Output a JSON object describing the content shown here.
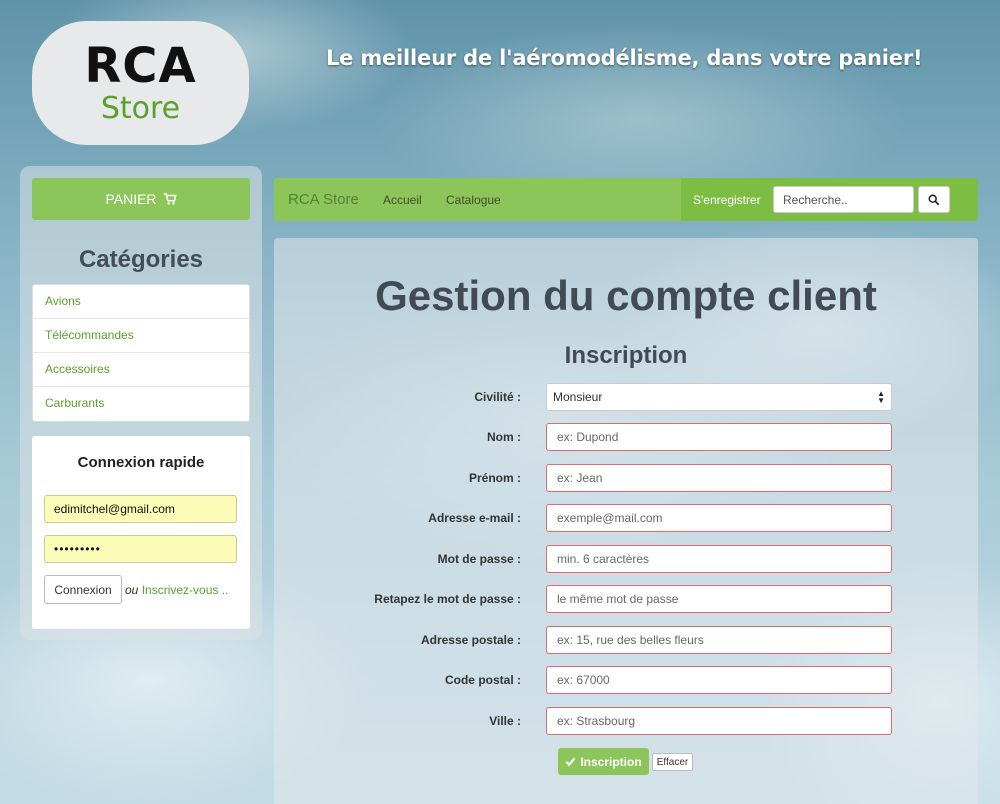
{
  "logo": {
    "line1": "RCA",
    "line2": "Store"
  },
  "tagline": "Le meilleur de l'aéromodélisme, dans votre panier!",
  "sidebar": {
    "cart_label": "PANIER",
    "categories_title": "Catégories",
    "categories": [
      "Avions",
      "Télécommandes",
      "Accessoires",
      "Carburants"
    ],
    "quick_login": {
      "title": "Connexion rapide",
      "email_value": "edimitchel@gmail.com",
      "password_value": "•••••••••",
      "login_button": "Connexion",
      "or_text": "ou",
      "register_link": "Inscrivez-vous .."
    }
  },
  "navbar": {
    "brand": "RCA Store",
    "links": [
      "Accueil",
      "Catalogue"
    ],
    "register": "S'enregistrer",
    "search_placeholder": "Recherche.."
  },
  "main": {
    "title": "Gestion du compte client",
    "subtitle": "Inscription",
    "fields": [
      {
        "label": "Civilité :",
        "type": "select",
        "value": "Monsieur"
      },
      {
        "label": "Nom :",
        "placeholder": "ex: Dupond"
      },
      {
        "label": "Prénom :",
        "placeholder": "ex: Jean"
      },
      {
        "label": "Adresse e-mail :",
        "placeholder": "exemple@mail.com"
      },
      {
        "label": "Mot de passe :",
        "placeholder": "min. 6 caractères"
      },
      {
        "label": "Retapez le mot de passe :",
        "placeholder": "le même mot de passe"
      },
      {
        "label": "Adresse postale :",
        "placeholder": "ex: 15, rue des belles fleurs"
      },
      {
        "label": "Code postal :",
        "placeholder": "ex: 67000"
      },
      {
        "label": "Ville :",
        "placeholder": "ex: Strasbourg"
      }
    ],
    "submit_label": "Inscription",
    "reset_label": "Effacer"
  },
  "colors": {
    "accent": "#8cc65a",
    "link_green": "#5aa02c",
    "error_border": "#e26a6a"
  }
}
